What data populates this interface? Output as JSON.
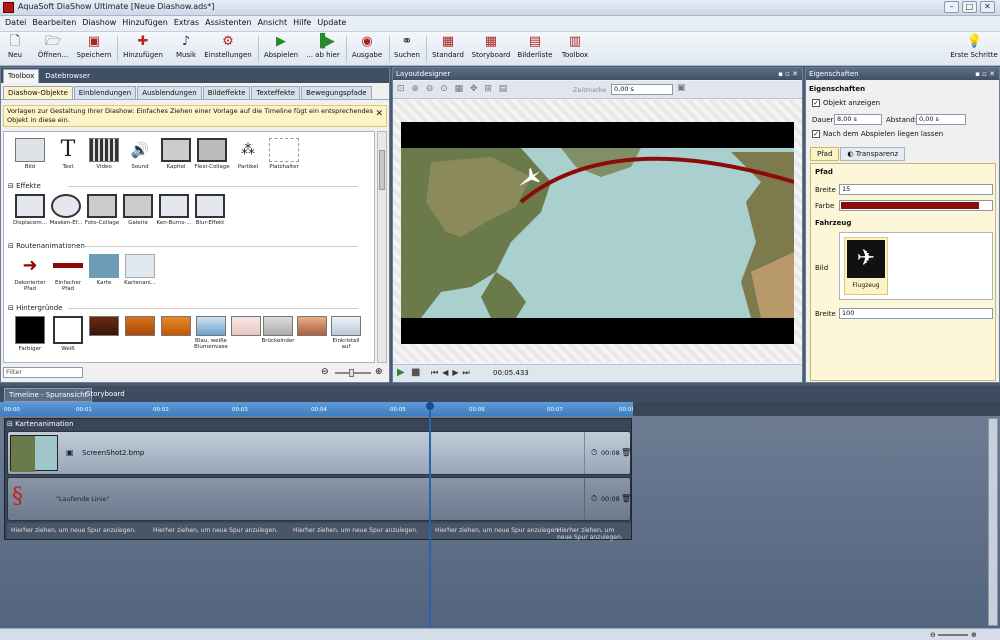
{
  "window": {
    "title": "AquaSoft DiaShow Ultimate [Neue Diashow.ads*]"
  },
  "menu": [
    "Datei",
    "Bearbeiten",
    "Diashow",
    "Hinzufügen",
    "Extras",
    "Assistenten",
    "Ansicht",
    "Hilfe",
    "Update"
  ],
  "toolbar": {
    "neu": "Neu",
    "oeffnen": "Öffnen...",
    "speichern": "Speichern",
    "hinzufuegen": "Hinzufügen",
    "musik": "Musik",
    "einstellungen": "Einstellungen",
    "abspielen": "Abspielen",
    "ab_hier": "... ab hier",
    "ausgabe": "Ausgabe",
    "suchen": "Suchen",
    "standard": "Standard",
    "storyboard": "Storyboard",
    "bilderliste": "Bilderliste",
    "toolbox": "Toolbox",
    "erste_schritte": "Erste Schritte"
  },
  "toolbox": {
    "tabs": [
      "Toolbox",
      "Datebrowser"
    ],
    "subtabs": [
      "Diashow-Objekte",
      "Einblendungen",
      "Ausblendungen",
      "Bildeffekte",
      "Texteffekte",
      "Bewegungspfade"
    ],
    "hint": "Vorlagen zur Gestaltung Ihrer Diashow: Einfaches Ziehen einer Vorlage auf die Timeline fügt ein entsprechendes Objekt in diese ein.",
    "objects": [
      "Bild",
      "Text",
      "Video",
      "Sound",
      "Kapitel",
      "Flexi-Collage",
      "Partikel",
      "Platzhalter"
    ],
    "effekte_title": "Effekte",
    "effekte": [
      "Displacem...",
      "Masken-Ef...",
      "Foto-Collage",
      "Galerie",
      "Ken-Burns-...",
      "Blur-Effekt"
    ],
    "routen_title": "Routenanimationen",
    "routen": [
      "Dekorierter Pfad",
      "Einfacher Pfad",
      "Karte",
      "Kartenani..."
    ],
    "hinter_title": "Hintergründe",
    "hinter": [
      "Farbiger",
      "Weiß",
      "Blau, weiße Blumenvase",
      "Brückelnder",
      "Einkristall auf"
    ],
    "filter": "Filter"
  },
  "layout": {
    "title": "Layoutdesigner",
    "zeitmarke_label": "Zeitmarke",
    "zeitmarke_value": "0,00 s",
    "time": "00:05.433"
  },
  "props": {
    "title": "Eigenschaften",
    "section": "Eigenschaften",
    "objekt_anzeigen": "Objekt anzeigen",
    "dauer_label": "Dauer:",
    "dauer_value": "8,00 s",
    "abstand_label": "Abstand:",
    "abstand_value": "0,00 s",
    "nach_abspielen": "Nach dem Abspielen liegen lassen",
    "tab_pfad": "Pfad",
    "tab_transparenz": "Transparenz",
    "pfad_title": "Pfad",
    "breite_label": "Breite",
    "breite_value": "15",
    "farbe_label": "Farbe",
    "farbe_color": "#8b0a0a",
    "fahrzeug_title": "Fahrzeug",
    "bild_label": "Bild",
    "flugzeug": "Flugzeug",
    "breite2_value": "100"
  },
  "timeline": {
    "tabs": [
      "Timeline - Spuransicht",
      "Storyboard"
    ],
    "ticks": [
      "00:00",
      "00:01",
      "00:02",
      "00:03",
      "00:04",
      "00:05",
      "00:06",
      "00:07",
      "00:08"
    ],
    "group_title": "Kartenanimation",
    "track1_name": "ScreenShot2.bmp",
    "track1_dur": "00:08",
    "track2_name": "\"Laufende Linie\"",
    "track2_dur": "00:08",
    "drop_hint": "Hierher ziehen, um neue Spur anzulegen."
  }
}
